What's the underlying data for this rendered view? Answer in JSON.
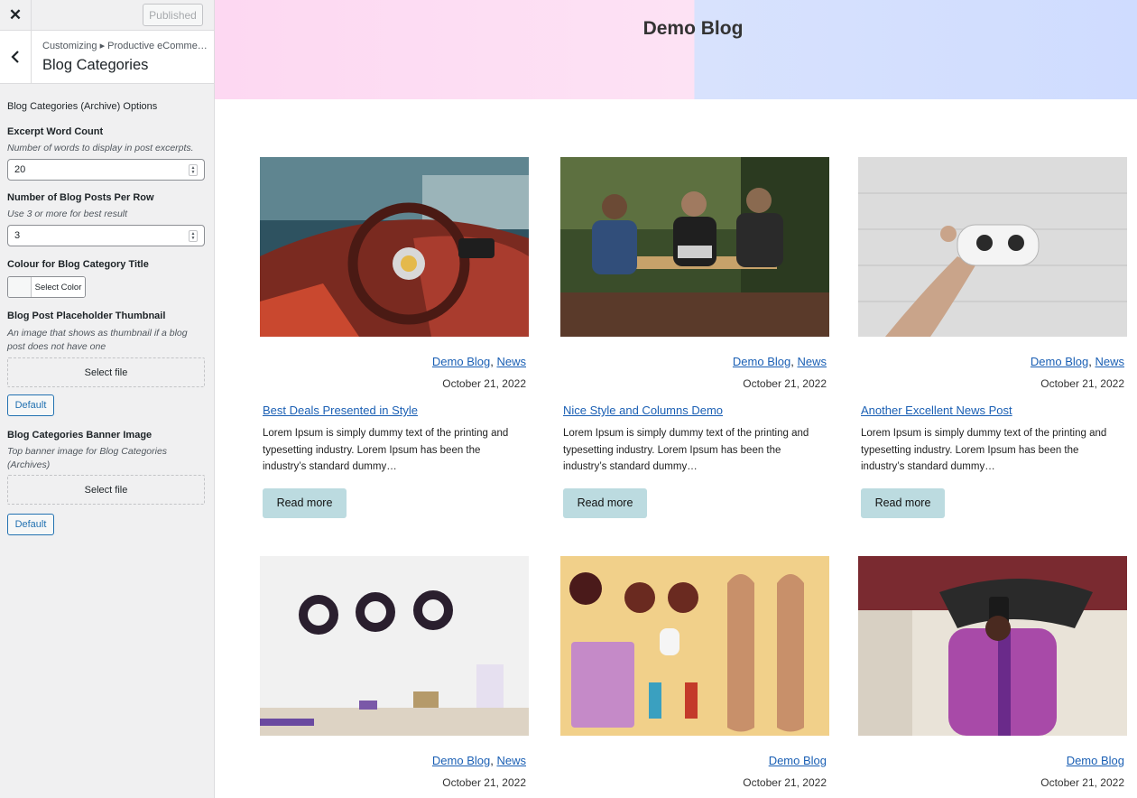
{
  "topbar": {
    "close_icon": "close-icon",
    "published_label": "Published"
  },
  "section": {
    "back_icon": "chevron-left-icon",
    "breadcrumb": "Customizing ▸ Productive eComme…",
    "title": "Blog Categories"
  },
  "controls": {
    "options_title": "Blog Categories (Archive) Options",
    "excerpt": {
      "label": "Excerpt Word Count",
      "desc": "Number of words to display in post excerpts.",
      "value": "20"
    },
    "per_row": {
      "label": "Number of Blog Posts Per Row",
      "desc": "Use 3 or more for best result",
      "value": "3"
    },
    "color": {
      "label": "Colour for Blog Category Title",
      "button": "Select Color"
    },
    "placeholder": {
      "label": "Blog Post Placeholder Thumbnail",
      "desc": "An image that shows as thumbnail if a blog post does not have one",
      "select": "Select file",
      "default": "Default"
    },
    "banner": {
      "label": "Blog Categories Banner Image",
      "desc": "Top banner image for Blog Categories (Archives)",
      "select": "Select file",
      "default": "Default"
    }
  },
  "preview": {
    "banner_title": "Demo Blog",
    "banner_colors": [
      "#fdd8f2",
      "#d8e2fd"
    ],
    "posts": [
      {
        "cat1": "Demo Blog",
        "sep": ",",
        "cat2": "News",
        "date": "October 21, 2022",
        "title": "Best Deals Presented in Style",
        "excerpt": "Lorem Ipsum is simply dummy text of the printing and typesetting industry. Lorem Ipsum has been the industry’s standard dummy…",
        "read_more": "Read more",
        "image": "car-interior-photo"
      },
      {
        "cat1": "Demo Blog",
        "sep": ",",
        "cat2": "News",
        "date": "October 21, 2022",
        "title": "Nice Style and Columns Demo",
        "excerpt": "Lorem Ipsum is simply dummy text of the printing and typesetting industry. Lorem Ipsum has been the industry’s standard dummy…",
        "read_more": "Read more",
        "image": "people-at-cafe-photo"
      },
      {
        "cat1": "Demo Blog",
        "sep": ",",
        "cat2": "News",
        "date": "October 21, 2022",
        "title": "Another Excellent News Post",
        "excerpt": "Lorem Ipsum is simply dummy text of the printing and typesetting industry. Lorem Ipsum has been the industry’s standard dummy…",
        "read_more": "Read more",
        "image": "drone-controller-photo"
      },
      {
        "cat1": "Demo Blog",
        "sep": ",",
        "cat2": "News",
        "date": "October 21, 2022",
        "image": "shop-wreaths-photo"
      },
      {
        "cat1": "Demo Blog",
        "date": "October 21, 2022",
        "image": "vacation-flatlay-photo"
      },
      {
        "cat1": "Demo Blog",
        "date": "October 21, 2022",
        "image": "man-with-phone-photo"
      }
    ]
  }
}
